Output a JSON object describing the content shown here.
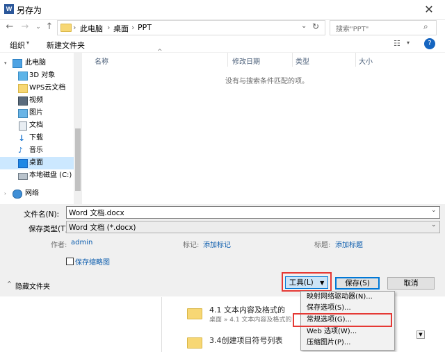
{
  "window": {
    "title": "另存为",
    "app_icon": "W"
  },
  "nav": {
    "breadcrumb": [
      "此电脑",
      "桌面",
      "PPT"
    ],
    "search_placeholder": "搜索\"PPT\""
  },
  "toolbar": {
    "organize": "组织",
    "new_folder": "新建文件夹"
  },
  "sidebar": {
    "items": [
      {
        "label": "此电脑",
        "icon": "computer-icon"
      },
      {
        "label": "3D 对象",
        "icon": "cube-icon"
      },
      {
        "label": "WPS云文档",
        "icon": "folder-icon"
      },
      {
        "label": "视频",
        "icon": "video-icon"
      },
      {
        "label": "图片",
        "icon": "picture-icon"
      },
      {
        "label": "文档",
        "icon": "document-icon"
      },
      {
        "label": "下载",
        "icon": "download-icon"
      },
      {
        "label": "音乐",
        "icon": "music-icon"
      },
      {
        "label": "桌面",
        "icon": "desktop-icon"
      },
      {
        "label": "本地磁盘 (C:)",
        "icon": "drive-icon"
      },
      {
        "label": "网络",
        "icon": "network-icon"
      }
    ]
  },
  "filelist": {
    "columns": [
      "名称",
      "修改日期",
      "类型",
      "大小"
    ],
    "empty_message": "没有与搜索条件匹配的项。"
  },
  "form": {
    "filename_label": "文件名(N):",
    "filename_value": "Word 文档.docx",
    "filetype_label": "保存类型(T):",
    "filetype_value": "Word 文档 (*.docx)",
    "author_label": "作者:",
    "author_value": "admin",
    "tags_label": "标记:",
    "tags_value": "添加标记",
    "title_label": "标题:",
    "title_value": "添加标题",
    "thumbnail_label": "保存缩略图",
    "thumbnail_checked": false,
    "hide_folders": "隐藏文件夹",
    "tools_button": "工具(L)",
    "save_button": "保存(S)",
    "cancel_button": "取消"
  },
  "tools_menu": {
    "items": [
      "映射网络驱动器(N)...",
      "保存选项(S)...",
      "常规选项(G)...",
      "Web 选项(W)...",
      "压缩图片(P)..."
    ],
    "highlighted_item": "常规选项(G)..."
  },
  "background_doc": {
    "entries": [
      {
        "title": "4.1 文本内容及格式的",
        "path": "桌面 » 4.1 文本内容及格式的"
      },
      {
        "title": "3.4创建项目符号列表"
      }
    ]
  },
  "colors": {
    "highlight": "#e53935",
    "selected_nav": "#cce8ff",
    "link": "#0b5cad"
  }
}
